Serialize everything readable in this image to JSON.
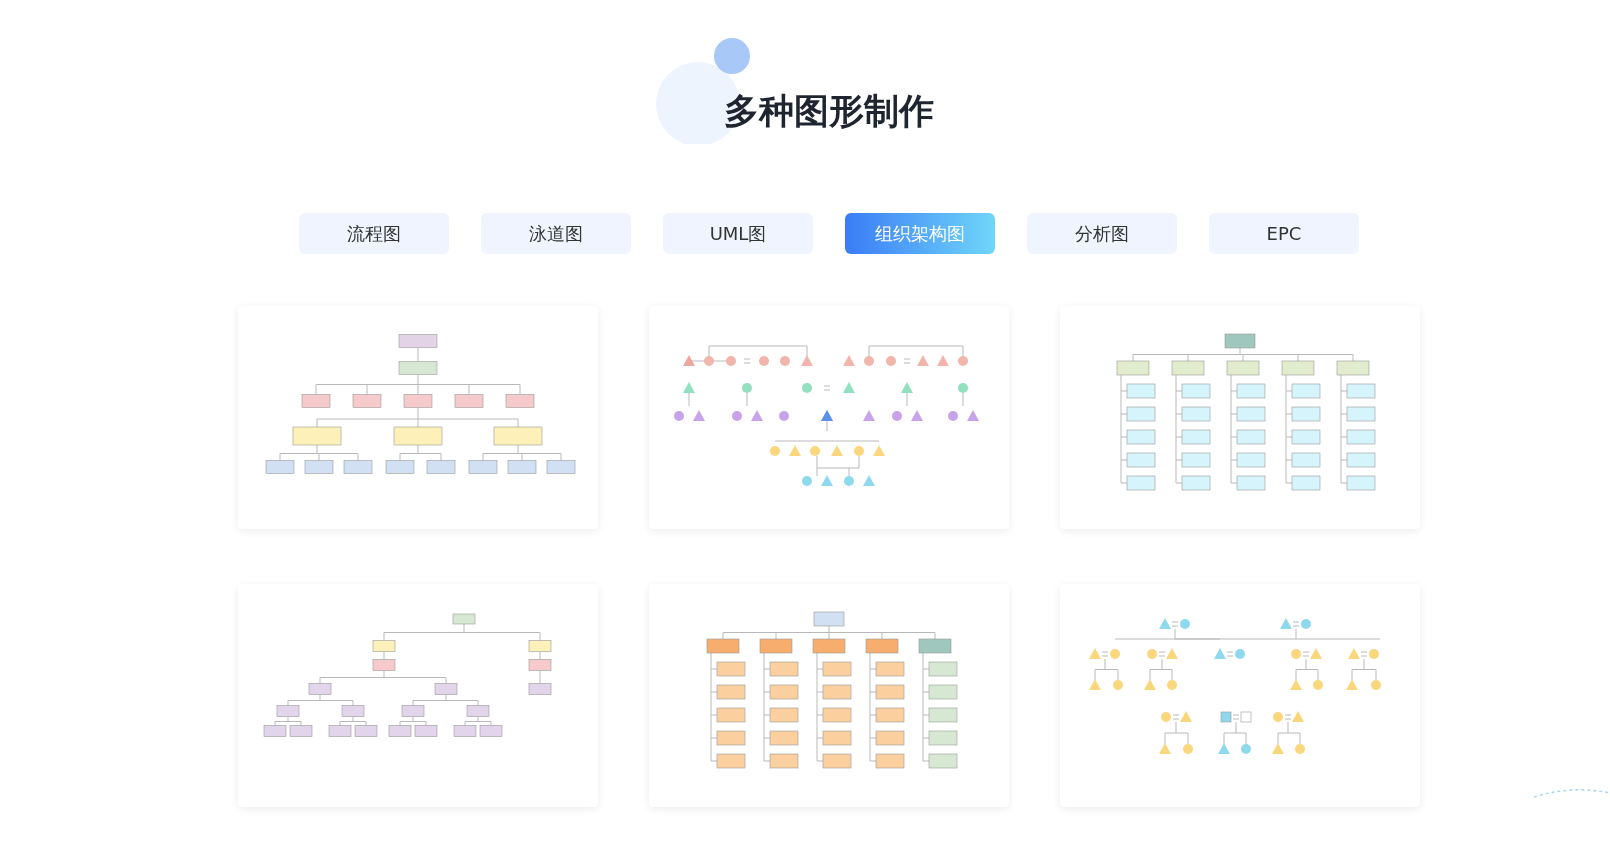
{
  "heading": "多种图形制作",
  "tabs": [
    {
      "label": "流程图",
      "selected": false
    },
    {
      "label": "泳道图",
      "selected": false
    },
    {
      "label": "UML图",
      "selected": false
    },
    {
      "label": "组织架构图",
      "selected": true
    },
    {
      "label": "分析图",
      "selected": false
    },
    {
      "label": "EPC",
      "selected": false
    }
  ],
  "cards": [
    {
      "kind": "tree"
    },
    {
      "kind": "genogram"
    },
    {
      "kind": "grid"
    },
    {
      "kind": "sparse-tree"
    },
    {
      "kind": "grid-orange"
    },
    {
      "kind": "genogram-small"
    }
  ]
}
